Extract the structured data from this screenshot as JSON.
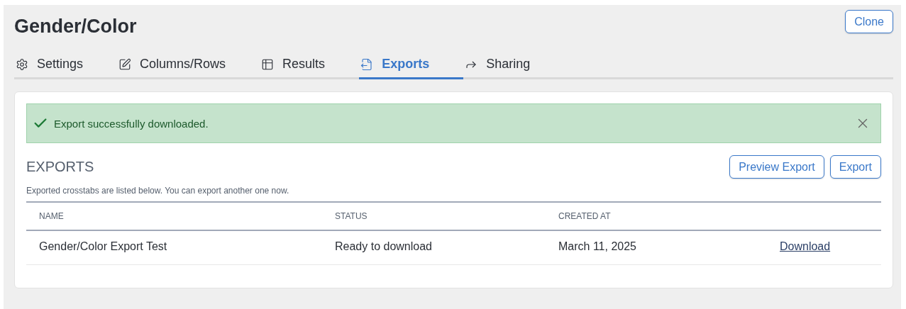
{
  "page": {
    "title": "Gender/Color",
    "clone_button": "Clone"
  },
  "tabs": [
    {
      "label": "Settings",
      "kind": "gear",
      "selected": false
    },
    {
      "label": "Columns/Rows",
      "kind": "edit",
      "selected": false
    },
    {
      "label": "Results",
      "kind": "table",
      "selected": false
    },
    {
      "label": "Exports",
      "kind": "file-export",
      "selected": true
    },
    {
      "label": "Sharing",
      "kind": "share",
      "selected": false
    }
  ],
  "alert": {
    "message": "Export successfully downloaded."
  },
  "exports": {
    "heading": "EXPORTS",
    "description": "Exported crosstabs are listed below. You can export another one now.",
    "buttons": [
      "Preview Export",
      "Export"
    ],
    "table": {
      "columns": [
        "NAME",
        "STATUS",
        "CREATED AT"
      ],
      "rows": [
        {
          "name": "Gender/Color Export Test",
          "status": "Ready to download",
          "created_at": "March 11, 2025",
          "action": "Download"
        }
      ]
    }
  }
}
